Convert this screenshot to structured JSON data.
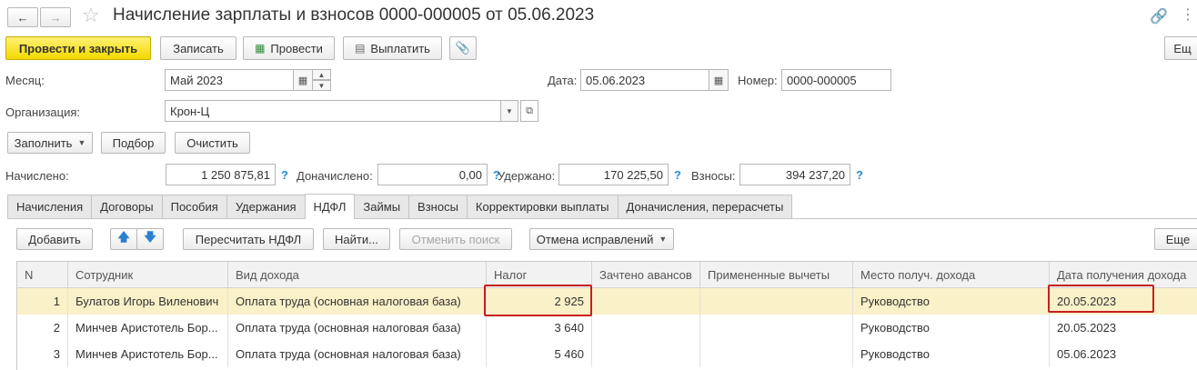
{
  "window": {
    "title": "Начисление зарплаты и взносов 0000-000005 от 05.06.2023"
  },
  "toolbar": {
    "post_close": "Провести и закрыть",
    "save": "Записать",
    "post": "Провести",
    "pay": "Выплатить",
    "more": "Ещ"
  },
  "form": {
    "month_label": "Месяц:",
    "month_value": "Май 2023",
    "date_label": "Дата:",
    "date_value": "05.06.2023",
    "number_label": "Номер:",
    "number_value": "0000-000005",
    "org_label": "Организация:",
    "org_value": "Крон-Ц"
  },
  "actions": {
    "fill": "Заполнить",
    "select": "Подбор",
    "clear": "Очистить"
  },
  "totals": {
    "accrued_label": "Начислено:",
    "accrued_value": "1 250 875,81",
    "extra_label": "Доначислено:",
    "extra_value": "0,00",
    "withheld_label": "Удержано:",
    "withheld_value": "170 225,50",
    "contrib_label": "Взносы:",
    "contrib_value": "394 237,20",
    "help": "?"
  },
  "tabs": [
    "Начисления",
    "Договоры",
    "Пособия",
    "Удержания",
    "НДФЛ",
    "Займы",
    "Взносы",
    "Корректировки выплаты",
    "Доначисления, перерасчеты"
  ],
  "active_tab": "НДФЛ",
  "grid_toolbar": {
    "add": "Добавить",
    "recalc": "Пересчитать НДФЛ",
    "find": "Найти...",
    "cancel_search": "Отменить поиск",
    "cancel_fix": "Отмена исправлений",
    "more": "Еще"
  },
  "table": {
    "columns": [
      "N",
      "Сотрудник",
      "Вид дохода",
      "Налог",
      "Зачтено авансов",
      "Примененные вычеты",
      "Место получ. дохода",
      "Дата получения дохода"
    ],
    "rows": [
      {
        "n": "1",
        "employee": "Булатов Игорь Виленович",
        "income": "Оплата труда (основная налоговая база)",
        "tax": "2 925",
        "advance": "",
        "deductions": "",
        "place": "Руководство",
        "date": "20.05.2023"
      },
      {
        "n": "2",
        "employee": "Минчев Аристотель Бор...",
        "income": "Оплата труда (основная налоговая база)",
        "tax": "3 640",
        "advance": "",
        "deductions": "",
        "place": "Руководство",
        "date": "20.05.2023"
      },
      {
        "n": "3",
        "employee": "Минчев Аристотель Бор...",
        "income": "Оплата труда (основная налоговая база)",
        "tax": "5 460",
        "advance": "",
        "deductions": "",
        "place": "Руководство",
        "date": "05.06.2023"
      }
    ]
  },
  "colors": {
    "primary_button": "#f4d800",
    "selected_row": "#fbf1c8",
    "highlight": "#c81e1e",
    "help": "#1f8fd6"
  }
}
